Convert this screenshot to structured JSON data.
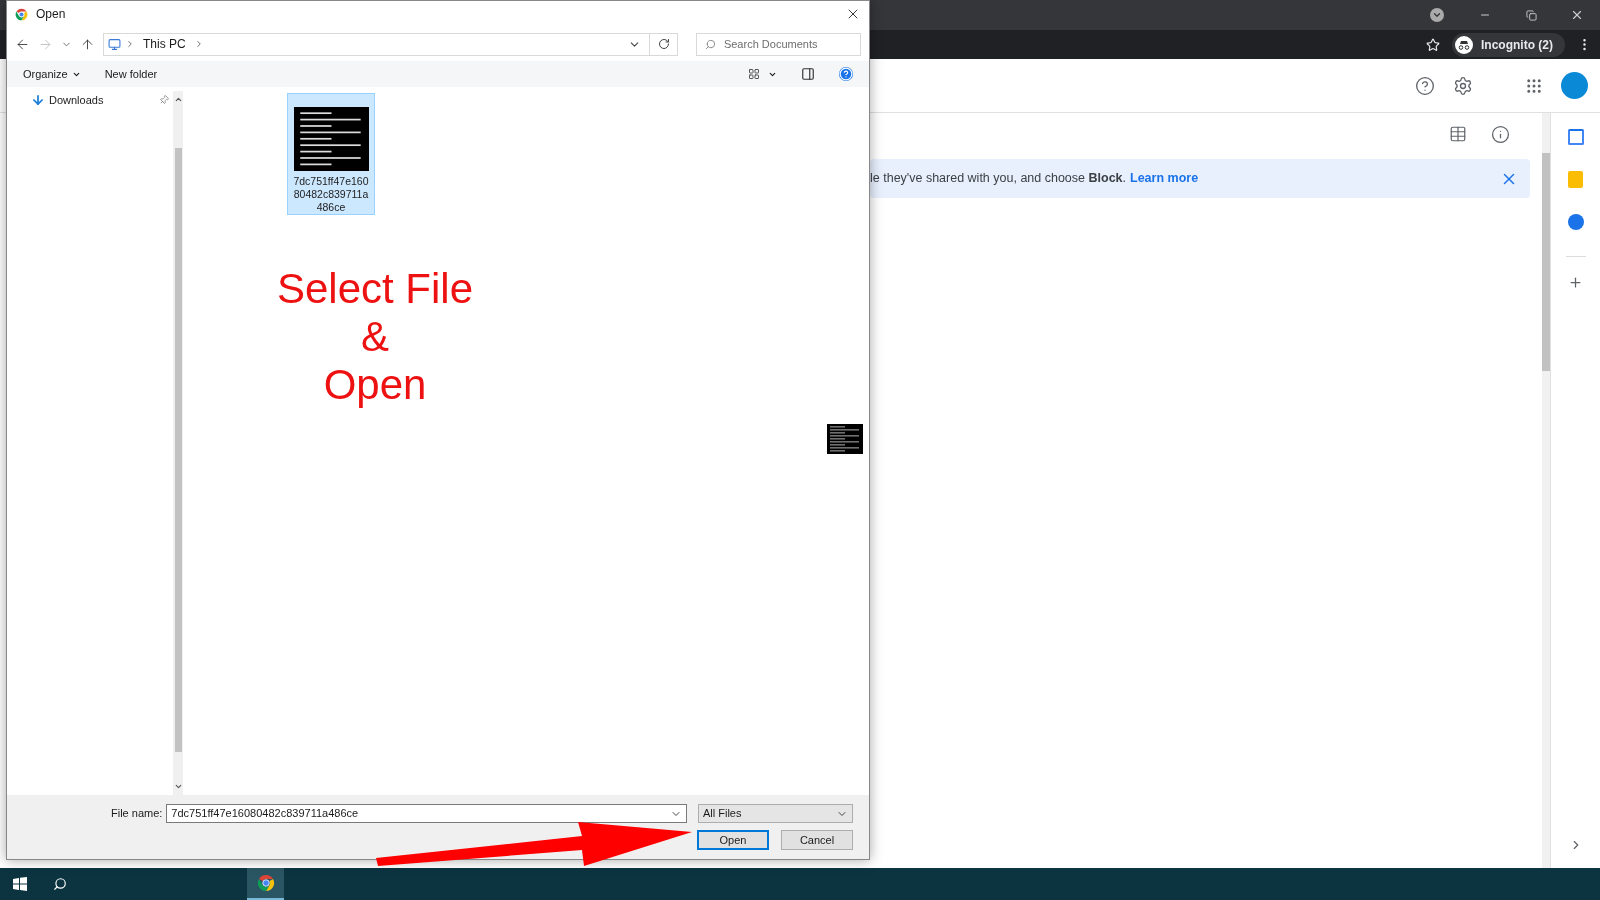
{
  "dialog": {
    "title": "Open",
    "address": {
      "crumbs": [
        "This PC"
      ]
    },
    "search": {
      "placeholder": "Search Documents"
    },
    "commands": [
      "Organize",
      "New folder"
    ],
    "nav": [
      {
        "label": "Downloads",
        "selected": false
      }
    ],
    "files": [
      {
        "name": "7dc751ff47e16080482c839711a486ce",
        "selected": true
      }
    ],
    "file_name": {
      "label": "File name:",
      "value": "7dc751ff47e16080482c839711a486ce"
    },
    "file_type": "All Files",
    "buttons": [
      {
        "label": "Open",
        "default": true
      },
      {
        "label": "Cancel",
        "default": false
      }
    ]
  },
  "annotation": {
    "lines": [
      "Select File",
      "&",
      "Open"
    ]
  },
  "browser": {
    "profile": "Incognito (2)",
    "banner": {
      "text": "le they've shared with you, and choose **Block**.",
      "link": "Learn more"
    }
  }
}
